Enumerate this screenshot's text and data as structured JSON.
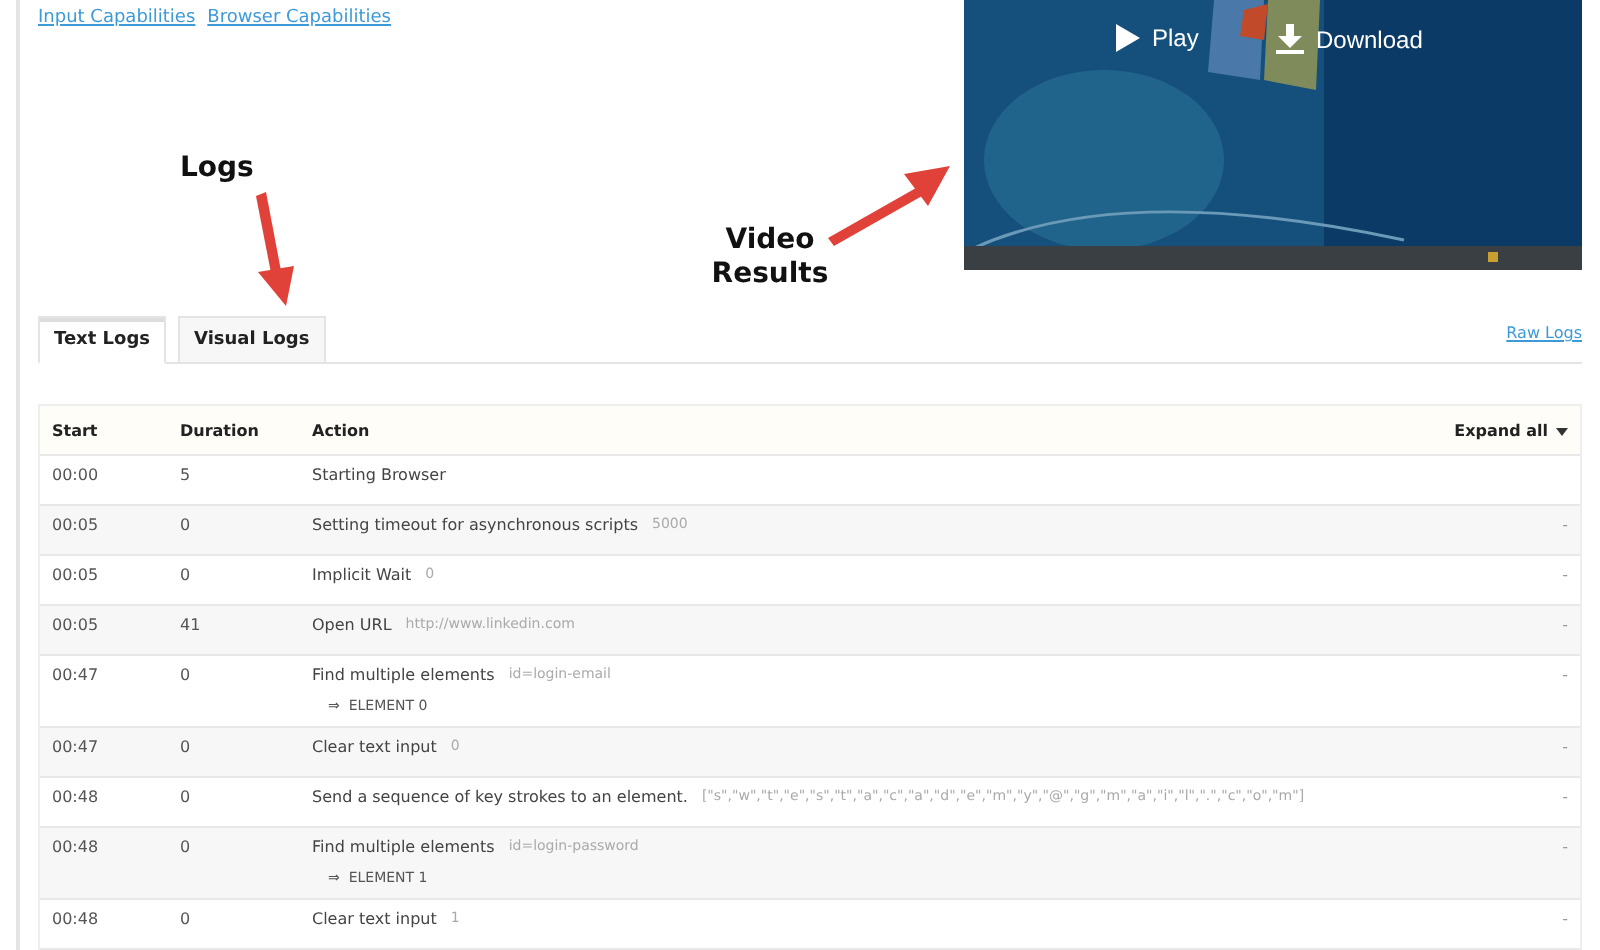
{
  "links": [
    "Input Capabilities",
    "Browser Capabilities"
  ],
  "video": {
    "controls": [
      {
        "kind": "play",
        "label": "Play"
      },
      {
        "kind": "download",
        "label": "Download"
      }
    ]
  },
  "annotations": [
    {
      "kind": "logs",
      "label": "Logs"
    },
    {
      "kind": "video",
      "label": "Video Results"
    }
  ],
  "tabs": [
    {
      "label": "Text Logs",
      "selected": true
    },
    {
      "label": "Visual Logs",
      "selected": false
    }
  ],
  "raw_logs": "Raw Logs",
  "table": {
    "columns": [
      "Start",
      "Duration",
      "Action"
    ],
    "expand_all": "Expand all",
    "rows": [
      {
        "start": "00:00",
        "duration": "5",
        "action": "Starting Browser"
      },
      {
        "start": "00:05",
        "duration": "0",
        "action": "Setting timeout for asynchronous scripts",
        "arg": "5000",
        "more": "-"
      },
      {
        "start": "00:05",
        "duration": "0",
        "action": "Implicit Wait",
        "arg": "0",
        "more": "-"
      },
      {
        "start": "00:05",
        "duration": "41",
        "action": "Open URL",
        "arg": "http://www.linkedin.com",
        "more": "-"
      },
      {
        "start": "00:47",
        "duration": "0",
        "action": "Find multiple elements",
        "arg": "id=login-email",
        "result_mark": "⇒",
        "result": "ELEMENT 0",
        "more": "-"
      },
      {
        "start": "00:47",
        "duration": "0",
        "action": "Clear text input",
        "arg": "0",
        "more": "-"
      },
      {
        "start": "00:48",
        "duration": "0",
        "action": "Send a sequence of key strokes to an element.",
        "arg": "[\"s\",\"w\",\"t\",\"e\",\"s\",\"t\",\"a\",\"c\",\"a\",\"d\",\"e\",\"m\",\"y\",\"@\",\"g\",\"m\",\"a\",\"i\",\"l\",\".\",\"c\",\"o\",\"m\"]",
        "more": "-"
      },
      {
        "start": "00:48",
        "duration": "0",
        "action": "Find multiple elements",
        "arg": "id=login-password",
        "result_mark": "⇒",
        "result": "ELEMENT 1",
        "more": "-"
      },
      {
        "start": "00:48",
        "duration": "0",
        "action": "Clear text input",
        "arg": "1",
        "more": "-"
      }
    ]
  }
}
